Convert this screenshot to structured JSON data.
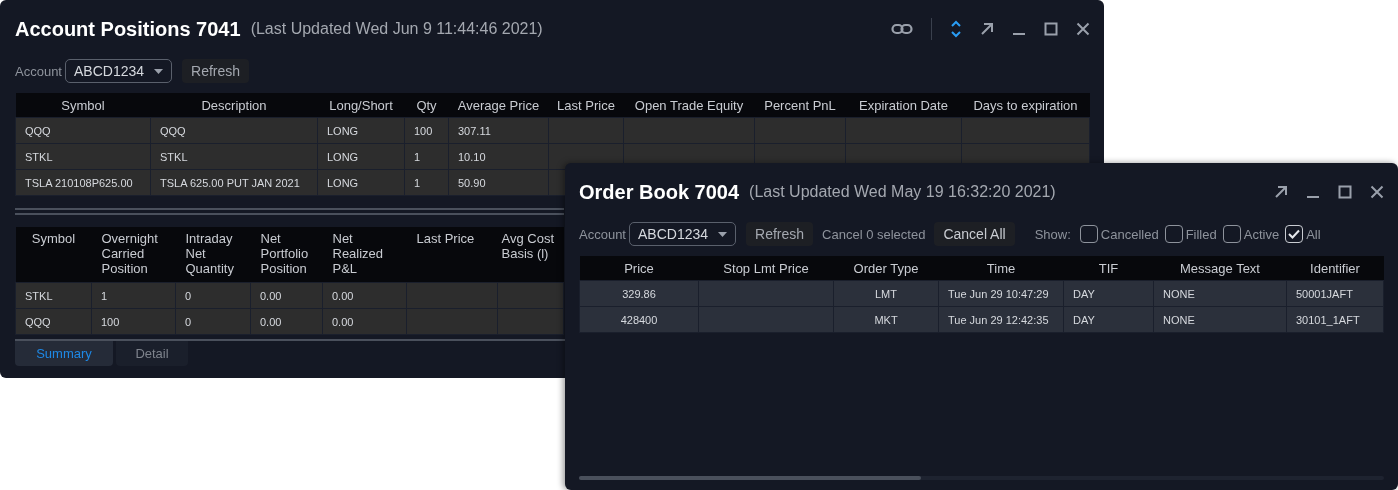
{
  "positions_window": {
    "title": "Account Positions 7041",
    "subtitle": "(Last Updated Wed Jun 9 11:44:46 2021)",
    "account_label": "Account",
    "account": "ABCD1234",
    "refresh": "Refresh",
    "positions_table": {
      "columns": [
        "Symbol",
        "Description",
        "Long/Short",
        "Qty",
        "Average Price",
        "Last Price",
        "Open Trade Equity",
        "Percent PnL",
        "Expiration Date",
        "Days to expiration"
      ],
      "rows": [
        [
          "QQQ",
          "QQQ",
          "LONG",
          "100",
          "307.11",
          "",
          "",
          "",
          "",
          ""
        ],
        [
          "STKL",
          "STKL",
          "LONG",
          "1",
          "10.10",
          "",
          "",
          "",
          "",
          ""
        ],
        [
          "TSLA 210108P625.00",
          "TSLA 625.00 PUT JAN 2021",
          "LONG",
          "1",
          "50.90",
          "",
          "",
          "",
          "",
          ""
        ]
      ]
    },
    "summary_table": {
      "columns": [
        "Symbol",
        "Overnight Carried Position",
        "Intraday Net Quantity",
        "Net Portfolio Position",
        "Net Realized P&L",
        "Last Price",
        "Avg Cost Basis (l)"
      ],
      "rows": [
        [
          "STKL",
          "1",
          "0",
          "0.00",
          "0.00",
          "",
          ""
        ],
        [
          "QQQ",
          "100",
          "0",
          "0.00",
          "0.00",
          "",
          ""
        ]
      ]
    },
    "tabs": [
      {
        "label": "Summary",
        "selected": true
      },
      {
        "label": "Detail",
        "selected": false
      }
    ]
  },
  "order_book_window": {
    "title": "Order Book 7004",
    "subtitle": "(Last Updated Wed May 19 16:32:20 2021)",
    "account_label": "Account",
    "account": "ABCD1234",
    "refresh": "Refresh",
    "cancel_selected": "Cancel 0 selected",
    "cancel_all": "Cancel All",
    "show_label": "Show:",
    "filters": [
      {
        "label": "Cancelled",
        "checked": false
      },
      {
        "label": "Filled",
        "checked": false
      },
      {
        "label": "Active",
        "checked": false
      },
      {
        "label": "All",
        "checked": true
      }
    ],
    "orders_table": {
      "columns": [
        "Price",
        "Stop Lmt Price",
        "Order Type",
        "Time",
        "TIF",
        "Message Text",
        "Identifier"
      ],
      "rows": [
        [
          "329.86",
          "",
          "LMT",
          "Tue Jun 29 10:47:29",
          "DAY",
          "NONE",
          "50001JAFT"
        ],
        [
          "428400",
          "",
          "MKT",
          "Tue Jun 29 12:42:35",
          "DAY",
          "NONE",
          "30101_1AFT"
        ]
      ]
    }
  }
}
